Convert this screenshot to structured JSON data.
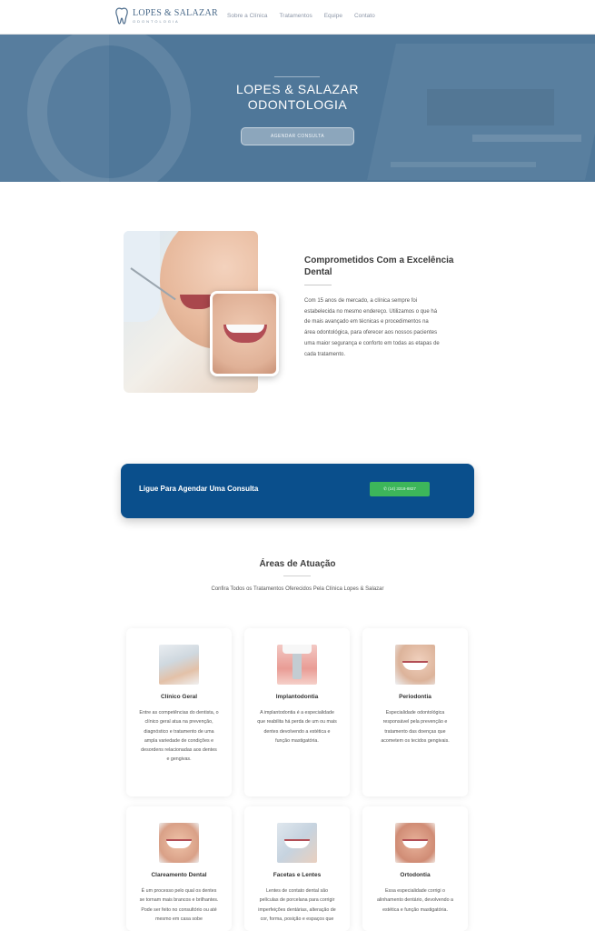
{
  "nav": {
    "logo_name": "LOPES & SALAZAR",
    "logo_sub": "ODONTOLOGIA",
    "menu": [
      "Sobre a Clínica",
      "Tratamentos",
      "Equipe",
      "Contato"
    ]
  },
  "hero": {
    "title_line1": "LOPES & SALAZAR",
    "title_line2": "ODONTOLOGIA",
    "cta": "AGENDAR CONSULTA"
  },
  "commitment": {
    "title": "Comprometidos Com a Excelência Dental",
    "text": "Com 15 anos de mercado, a clínica sempre foi estabelecida no mesmo endereço. Utilizamos o que há de mais avançado em técnicas e procedimentos na área odontológica, para oferecer aos nossos pacientes uma maior segurança e conforto em todas as etapas de cada tratamento."
  },
  "callband": {
    "text": "Ligue Para Agendar Uma Consulta",
    "phone": "(14) 3318-8827"
  },
  "areas": {
    "title": "Áreas de Atuação",
    "subtitle": "Confira Todos os Tratamentos Oferecidos Pela Clínica Lopes & Salazar",
    "cards": [
      {
        "title": "Clínico Geral",
        "text": "Entre as competências do dentista, o clínico geral atua na prevenção, diagnóstico e tratamento de uma ampla variedade de condições e desordens relacionadas aos dentes e gengivas.",
        "icon": "dentist-patient-photo"
      },
      {
        "title": "Implantodontia",
        "text": "A implantodontia é a especialidade que reabilita há perda de um ou mais dentes devolvendo a estética e função mastigatória.",
        "icon": "dental-implant-photo"
      },
      {
        "title": "Periodontia",
        "text": "Especialidade odontológica responsável pela prevenção e tratamento das doenças que acometem os tecidos gengivais.",
        "icon": "smiling-woman-photo"
      },
      {
        "title": "Clareamento Dental",
        "text": "É um processo pelo qual os dentes se tornam mais brancos e brilhantes. Pode ser feito no consultório ou até mesmo em casa sobe",
        "icon": "whitening-smile-photo"
      },
      {
        "title": "Facetas e Lentes",
        "text": "Lentes de contato dental são películas de porcelana para corrigir imperfeições dentárias, alteração de cor, forma, posição e espaços que",
        "icon": "veneers-photo"
      },
      {
        "title": "Ortodontia",
        "text": "Essa especialidade corrigi o alinhamento dentário, devolvendo a estética e função mastigatória.",
        "icon": "orthodontics-photo"
      }
    ]
  }
}
